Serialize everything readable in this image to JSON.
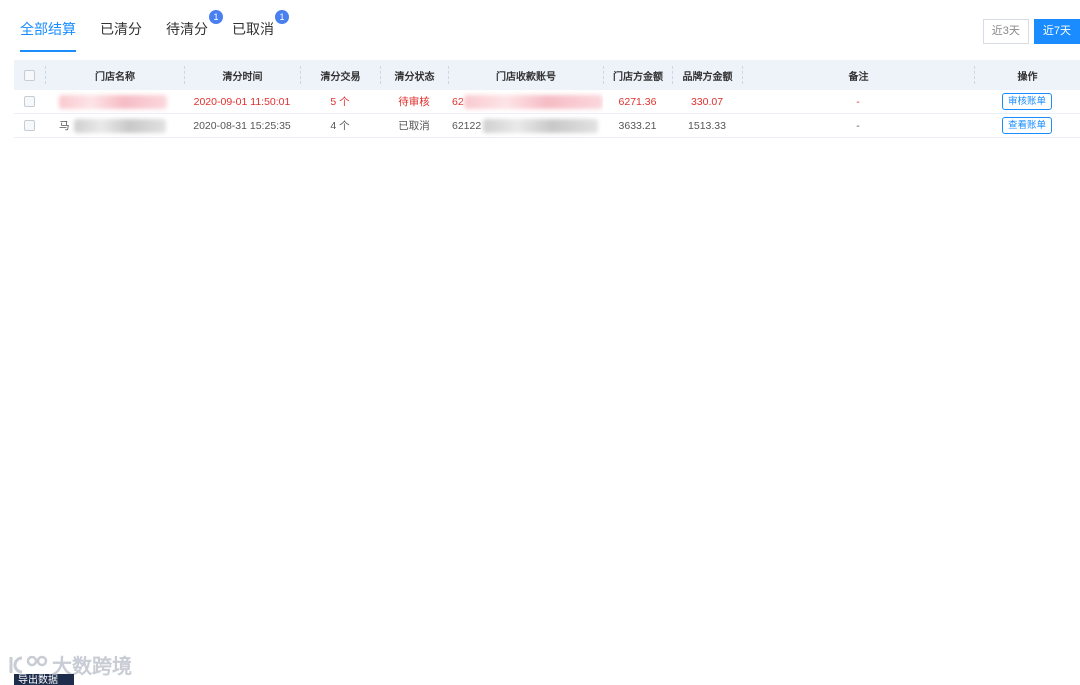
{
  "tabs": [
    {
      "label": "全部结算",
      "active": true
    },
    {
      "label": "已清分"
    },
    {
      "label": "待清分",
      "badge": "1"
    },
    {
      "label": "已取消",
      "badge": "1"
    }
  ],
  "range_buttons": {
    "near3": "近3天",
    "near7": "近7天",
    "active": "near7"
  },
  "table": {
    "headers": [
      "门店名称",
      "清分时间",
      "清分交易",
      "清分状态",
      "门店收款账号",
      "门店方金额",
      "品牌方金额",
      "备注",
      "操作"
    ],
    "rows": [
      {
        "store": "",
        "time": "2020-09-01 11:50:01",
        "count": "5 个",
        "status": "待审核",
        "account": "62",
        "store_amount": "6271.36",
        "brand_amount": "330.07",
        "remark": "-",
        "action": "审核账单"
      },
      {
        "store": "马",
        "time": "2020-08-31 15:25:35",
        "count": "4 个",
        "status": "已取消",
        "account": "62122",
        "store_amount": "3633.21",
        "brand_amount": "1513.33",
        "remark": "-",
        "action": "查看账单"
      }
    ]
  },
  "colors": {
    "accent": "#1a8cff",
    "pending": "#e0302d",
    "badge": "#4a7ff0"
  },
  "watermark": "大数跨境",
  "export_label": "导出数据"
}
